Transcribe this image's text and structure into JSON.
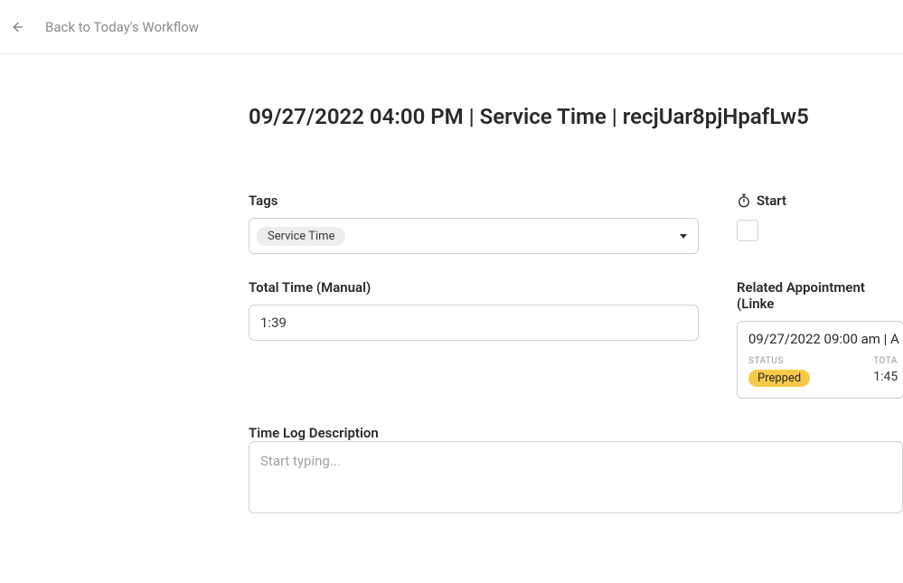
{
  "topbar": {
    "back_label": "Back to Today's Workflow"
  },
  "page_title": "09/27/2022 04:00 PM | Service Time | recjUar8pjHpafLw5",
  "tags": {
    "label": "Tags",
    "selected": "Service Time"
  },
  "start": {
    "label": "Start",
    "checked": false
  },
  "total_time": {
    "label": "Total Time (Manual)",
    "value": "1:39"
  },
  "related": {
    "section_label": "Related Appointment (Linke",
    "title": "09/27/2022 09:00 am | A",
    "status_label": "STATUS",
    "status_value": "Prepped",
    "total_label": "TOTA",
    "total_value": "1:45"
  },
  "description": {
    "label": "Time Log Description",
    "placeholder": "Start typing...",
    "value": ""
  }
}
